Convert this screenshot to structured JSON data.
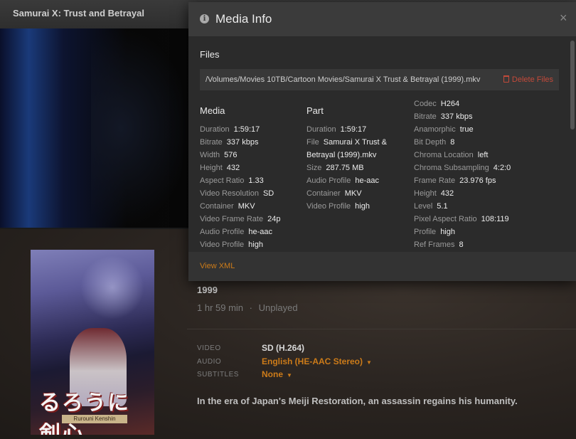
{
  "app": {
    "title": "Samurai X: Trust and Betrayal"
  },
  "details": {
    "year": "1999",
    "duration": "1 hr 59 min",
    "separator": "·",
    "status": "Unplayed",
    "video_label": "VIDEO",
    "video_value": "SD (H.264)",
    "audio_label": "AUDIO",
    "audio_value": "English (HE-AAC Stereo)",
    "subtitles_label": "SUBTITLES",
    "subtitles_value": "None",
    "summary": "In the era of Japan's Meiji Restoration, an assassin regains his humanity."
  },
  "poster": {
    "logo_text": "るろうに剣心",
    "subtitle": "Rurouni Kenshin"
  },
  "modal": {
    "title": "Media Info",
    "close_symbol": "×",
    "files_heading": "Files",
    "file_path": "/Volumes/Movies 10TB/Cartoon Movies/Samurai X Trust & Betrayal (1999).mkv",
    "delete_label": "Delete Files",
    "media_heading": "Media",
    "part_heading": "Part",
    "view_xml": "View XML",
    "media": [
      {
        "k": "Duration",
        "v": "1:59:17"
      },
      {
        "k": "Bitrate",
        "v": "337 kbps"
      },
      {
        "k": "Width",
        "v": "576"
      },
      {
        "k": "Height",
        "v": "432"
      },
      {
        "k": "Aspect Ratio",
        "v": "1.33"
      },
      {
        "k": "Video Resolution",
        "v": "SD"
      },
      {
        "k": "Container",
        "v": "MKV"
      },
      {
        "k": "Video Frame Rate",
        "v": "24p"
      },
      {
        "k": "Audio Profile",
        "v": "he-aac"
      },
      {
        "k": "Video Profile",
        "v": "high"
      }
    ],
    "part": [
      {
        "k": "Duration",
        "v": "1:59:17"
      },
      {
        "k": "File",
        "v": "Samurai X Trust &"
      },
      {
        "k": "",
        "v": "Betrayal (1999).mkv"
      },
      {
        "k": "Size",
        "v": "287.75 MB"
      },
      {
        "k": "Audio Profile",
        "v": "he-aac"
      },
      {
        "k": "Container",
        "v": "MKV"
      },
      {
        "k": "Video Profile",
        "v": "high"
      }
    ],
    "stream": [
      {
        "k": "Codec",
        "v": "H264"
      },
      {
        "k": "Bitrate",
        "v": "337 kbps"
      },
      {
        "k": "Anamorphic",
        "v": "true"
      },
      {
        "k": "Bit Depth",
        "v": "8"
      },
      {
        "k": "Chroma Location",
        "v": "left"
      },
      {
        "k": "Chroma Subsampling",
        "v": "4:2:0"
      },
      {
        "k": "Frame Rate",
        "v": "23.976 fps"
      },
      {
        "k": "Height",
        "v": "432"
      },
      {
        "k": "Level",
        "v": "5.1"
      },
      {
        "k": "Pixel Aspect Ratio",
        "v": "108:119"
      },
      {
        "k": "Profile",
        "v": "high"
      },
      {
        "k": "Ref Frames",
        "v": "8"
      }
    ]
  }
}
